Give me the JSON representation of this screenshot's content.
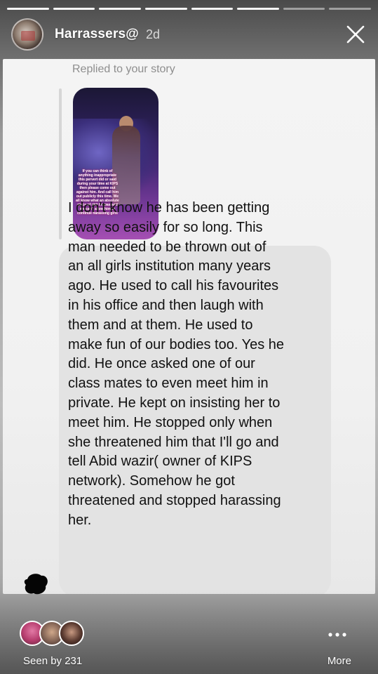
{
  "story": {
    "progress": {
      "total_segments": 8,
      "completed_segments": 6
    },
    "header": {
      "username": "Harrassers@",
      "time_ago": "2d",
      "close_icon": "close-icon"
    },
    "conversation": {
      "replied_label": "Replied to your story",
      "thumbnail_caption": "If you can think of anything inappropriate this pervert did or said during your time at KIPS then please come out against him. And call him out publicly this time. We all know what an absolute piece of shit he was and we can't allow him to continue harassing girls",
      "message_lines": [
        "I don't know he has been getting",
        "away so easily  for so long. This",
        "man needed to be thrown out of",
        "an all girls institution many years",
        "ago. He used to call his favourites",
        "in his office and then laugh with",
        "them and at them. He used to",
        "make fun of our bodies too. Yes he",
        "did. He once asked one of our",
        "class mates to even meet him in",
        "private. He kept on insisting her to",
        "meet him. He stopped only when",
        "she threatened him that I'll go and",
        "tell Abid wazir( owner of KIPS",
        "network). Somehow he got",
        "threatened and stopped harassing",
        "her."
      ]
    },
    "footer": {
      "seen_by": "Seen by 231",
      "more_label": "More",
      "more_icon": "more-dots-icon"
    }
  }
}
